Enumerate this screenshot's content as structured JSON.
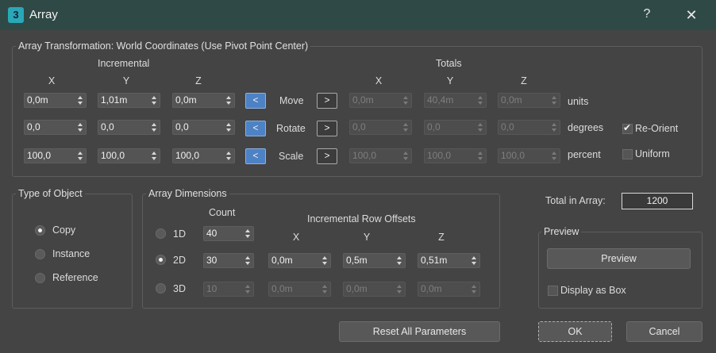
{
  "window": {
    "title": "Array",
    "app_icon_glyph": "3",
    "help_glyph": "?",
    "close_glyph": "✕"
  },
  "transform": {
    "legend": "Array Transformation: World Coordinates (Use Pivot Point Center)",
    "incremental_label": "Incremental",
    "totals_label": "Totals",
    "axes": [
      "X",
      "Y",
      "Z"
    ],
    "rows": [
      {
        "name": "Move",
        "inc": [
          "0,0m",
          "1,01m",
          "0,0m"
        ],
        "tot": [
          "0,0m",
          "40,4m",
          "0,0m"
        ],
        "unit": "units"
      },
      {
        "name": "Rotate",
        "inc": [
          "0,0",
          "0,0",
          "0,0"
        ],
        "tot": [
          "0,0",
          "0,0",
          "0,0"
        ],
        "unit": "degrees"
      },
      {
        "name": "Scale",
        "inc": [
          "100,0",
          "100,0",
          "100,0"
        ],
        "tot": [
          "100,0",
          "100,0",
          "100,0"
        ],
        "unit": "percent"
      }
    ],
    "left_arrow": "<",
    "right_arrow": ">",
    "reorient": {
      "label": "Re-Orient",
      "checked": true
    },
    "uniform": {
      "label": "Uniform",
      "checked": false
    }
  },
  "type_of_object": {
    "legend": "Type of Object",
    "options": [
      {
        "label": "Copy",
        "selected": true
      },
      {
        "label": "Instance",
        "selected": false
      },
      {
        "label": "Reference",
        "selected": false
      }
    ]
  },
  "dimensions": {
    "legend": "Array Dimensions",
    "count_label": "Count",
    "offsets_label": "Incremental Row Offsets",
    "axes": [
      "X",
      "Y",
      "Z"
    ],
    "rows": [
      {
        "label": "1D",
        "selected": false,
        "count": "40",
        "offsets": []
      },
      {
        "label": "2D",
        "selected": true,
        "count": "30",
        "offsets": [
          "0,0m",
          "0,5m",
          "0,51m"
        ]
      },
      {
        "label": "3D",
        "selected": false,
        "count": "10",
        "offsets": [
          "0,0m",
          "0,0m",
          "0,0m"
        ]
      }
    ]
  },
  "total": {
    "label": "Total in Array:",
    "value": "1200"
  },
  "preview": {
    "legend": "Preview",
    "button": "Preview",
    "display_as_box": "Display as Box",
    "display_as_box_checked": false
  },
  "footer": {
    "reset": "Reset All Parameters",
    "ok": "OK",
    "cancel": "Cancel"
  }
}
